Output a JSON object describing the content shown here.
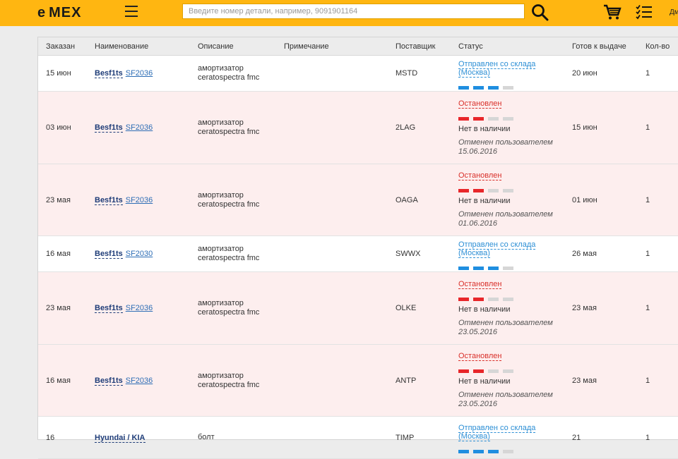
{
  "header": {
    "logo_left": "e",
    "logo_mid": "M",
    "logo_e": "E",
    "logo_right": "X",
    "search_placeholder": "Введите номер детали, например, 9091901164",
    "user": "Дм"
  },
  "table": {
    "columns": [
      "Заказан",
      "Наименование",
      "Описание",
      "Примечание",
      "Поставщик",
      "Статус",
      "Готов к выдаче",
      "Кол-во"
    ],
    "rows": [
      {
        "date": "15 июн",
        "brand": "Besf1ts",
        "part": "SF2036",
        "desc1": "амортизатор",
        "desc2": "ceratospectra fmc",
        "note": "",
        "supplier": "MSTD",
        "status": "Отправлен со склада (Москва)",
        "state": "ok",
        "progress": 3,
        "availability": "",
        "cancel1": "",
        "cancel2": "",
        "ready": "20 июн",
        "qty": "1"
      },
      {
        "date": "03 июн",
        "brand": "Besf1ts",
        "part": "SF2036",
        "desc1": "амортизатор",
        "desc2": "ceratospectra fmc",
        "note": "",
        "supplier": "2LAG",
        "status": "Остановлен",
        "state": "stopped",
        "progress": 2,
        "availability": "Нет в наличии",
        "cancel1": "Отменен пользователем",
        "cancel2": "15.06.2016",
        "ready": "15 июн",
        "qty": "1"
      },
      {
        "date": "23 мая",
        "brand": "Besf1ts",
        "part": "SF2036",
        "desc1": "амортизатор",
        "desc2": "ceratospectra fmc",
        "note": "",
        "supplier": "OAGA",
        "status": "Остановлен",
        "state": "stopped",
        "progress": 2,
        "availability": "Нет в наличии",
        "cancel1": "Отменен пользователем",
        "cancel2": "01.06.2016",
        "ready": "01 июн",
        "qty": "1"
      },
      {
        "date": "16 мая",
        "brand": "Besf1ts",
        "part": "SF2030",
        "desc1": "амортизатор",
        "desc2": "ceratospectra fmc",
        "note": "",
        "supplier": "SWWX",
        "status": "Отправлен со склада (Москва)",
        "state": "ok",
        "progress": 3,
        "availability": "",
        "cancel1": "",
        "cancel2": "",
        "ready": "26 мая",
        "qty": "1"
      },
      {
        "date": "23 мая",
        "brand": "Besf1ts",
        "part": "SF2036",
        "desc1": "амортизатор",
        "desc2": "ceratospectra fmc",
        "note": "",
        "supplier": "OLKE",
        "status": "Остановлен",
        "state": "stopped",
        "progress": 2,
        "availability": "Нет в наличии",
        "cancel1": "Отменен пользователем",
        "cancel2": "23.05.2016",
        "ready": "23 мая",
        "qty": "1"
      },
      {
        "date": "16 мая",
        "brand": "Besf1ts",
        "part": "SF2036",
        "desc1": "амортизатор",
        "desc2": "ceratospectra fmc",
        "note": "",
        "supplier": "ANTP",
        "status": "Остановлен",
        "state": "stopped",
        "progress": 2,
        "availability": "Нет в наличии",
        "cancel1": "Отменен пользователем",
        "cancel2": "23.05.2016",
        "ready": "23 мая",
        "qty": "1"
      },
      {
        "date": "16",
        "brand": "Hyundai / KIA",
        "part": "",
        "desc1": "болт",
        "desc2": "",
        "note": "",
        "supplier": "TIMP",
        "status": "Отправлен со склада (Москва)",
        "state": "ok",
        "progress": 3,
        "availability": "",
        "cancel1": "",
        "cancel2": "",
        "ready": "21",
        "qty": "1"
      }
    ]
  },
  "colors": {
    "header_bg": "#ffb611",
    "stopped_bg": "#fdeeee",
    "progress_blue": "#1f8ee0",
    "progress_red": "#e8262a",
    "progress_grey": "#d6d6d6"
  },
  "icons": {
    "menu": "hamburger-icon",
    "search": "search-icon",
    "cart": "cart-icon",
    "orders": "checklist-icon"
  }
}
